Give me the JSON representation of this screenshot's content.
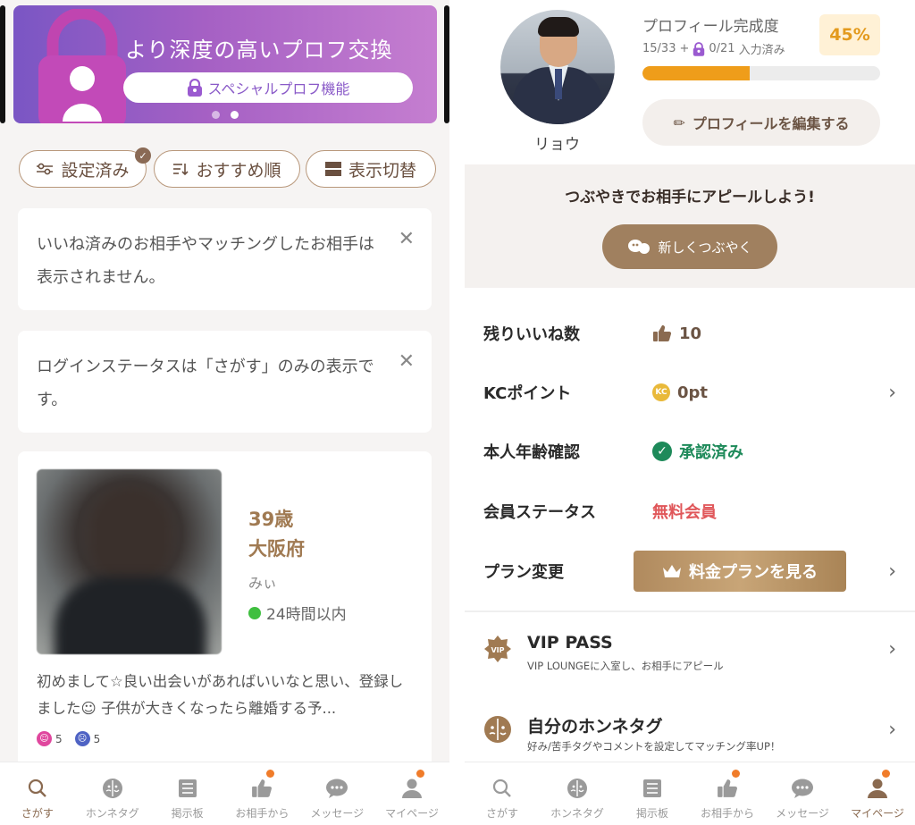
{
  "left": {
    "banner": {
      "title": "より深度の高いプロフ交換",
      "pill_label": "スペシャルプロフ機能"
    },
    "filters": [
      {
        "label": "設定済み",
        "icon": "sliders-icon"
      },
      {
        "label": "おすすめ順",
        "icon": "sort-icon"
      },
      {
        "label": "表示切替",
        "icon": "layout-icon"
      }
    ],
    "notices": [
      {
        "text": "いいね済みのお相手やマッチングしたお相手は表示されません。"
      },
      {
        "text": "ログインステータスは「さがす」のみの表示です。"
      }
    ],
    "profile": {
      "age": "39歳",
      "prefecture": "大阪府",
      "nickname": "みぃ",
      "online": "24時間以内",
      "intro": "初めまして☆良い出会いがあればいいなと思い、登録しました☺ 子供が大きくなったら離婚する予...",
      "reactions": [
        {
          "icon": "smile-icon",
          "count": "5",
          "color": "#e0479e"
        },
        {
          "icon": "sad-icon",
          "count": "5",
          "color": "#4f63c4"
        }
      ]
    }
  },
  "tabs_left": [
    {
      "label": "さがす",
      "icon": "search-icon",
      "active": true,
      "notif": false
    },
    {
      "label": "ホンネタグ",
      "icon": "tag-face-icon",
      "active": false,
      "notif": false
    },
    {
      "label": "掲示板",
      "icon": "board-icon",
      "active": false,
      "notif": false
    },
    {
      "label": "お相手から",
      "icon": "thumbs-up-icon",
      "active": false,
      "notif": true
    },
    {
      "label": "メッセージ",
      "icon": "chat-icon",
      "active": false,
      "notif": false
    },
    {
      "label": "マイページ",
      "icon": "person-icon",
      "active": false,
      "notif": true
    }
  ],
  "right": {
    "username": "リョウ",
    "completion": {
      "title": "プロフィール完成度",
      "count": "15/33",
      "plus": "+",
      "locked_count": "0/21",
      "filled_label": "入力済み",
      "percent_label": "45%",
      "percent": 45
    },
    "edit_label": "プロフィールを編集する",
    "tweet": {
      "title": "つぶやきでお相手にアピールしよう!",
      "button": "新しくつぶやく"
    },
    "rows": {
      "likes": {
        "label": "残りいいね数",
        "value": "10"
      },
      "kc": {
        "label": "KCポイント",
        "value": "0pt",
        "coin": "KC"
      },
      "age_verify": {
        "label": "本人年齢確認",
        "value": "承認済み"
      },
      "member": {
        "label": "会員ステータス",
        "value": "無料会員"
      },
      "plan": {
        "label": "プラン変更",
        "button": "料金プランを見る"
      }
    },
    "menu": [
      {
        "title": "VIP PASS",
        "sub": "VIP LOUNGEに入室し、お相手にアピール",
        "icon": "vip-badge-icon",
        "badge_text": "VIP"
      },
      {
        "title": "自分のホンネタグ",
        "sub": "好み/苦手タグやコメントを設定してマッチング率UP！",
        "icon": "tag-face-icon"
      }
    ]
  },
  "tabs_right": [
    {
      "label": "さがす",
      "icon": "search-icon",
      "active": false,
      "notif": false
    },
    {
      "label": "ホンネタグ",
      "icon": "tag-face-icon",
      "active": false,
      "notif": false
    },
    {
      "label": "掲示板",
      "icon": "board-icon",
      "active": false,
      "notif": false
    },
    {
      "label": "お相手から",
      "icon": "thumbs-up-icon",
      "active": false,
      "notif": true
    },
    {
      "label": "メッセージ",
      "icon": "chat-icon",
      "active": false,
      "notif": false
    },
    {
      "label": "マイページ",
      "icon": "person-icon",
      "active": true,
      "notif": true
    }
  ],
  "colors": {
    "brand_brown": "#8a6a50",
    "banner_start": "#7a56c4",
    "banner_end": "#c57ed0",
    "progress": "#ef9d1a",
    "approved": "#1e8a5a",
    "free_member": "#e0575a",
    "notification": "#f07c2a"
  }
}
